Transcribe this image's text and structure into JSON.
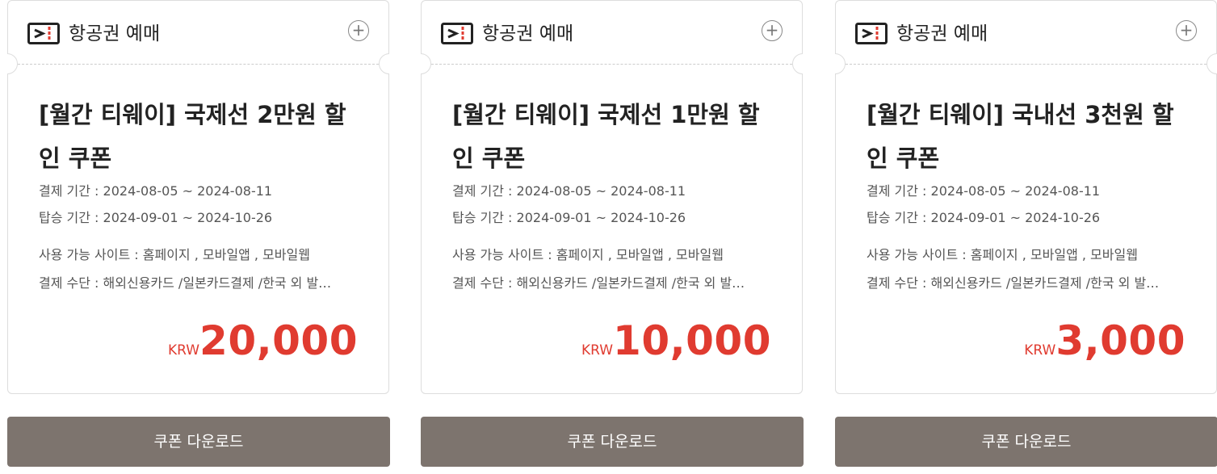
{
  "coupons": [
    {
      "category": "항공권 예매",
      "title": "[월간 티웨이] 국제선 2만원 할인 쿠폰",
      "payment_period": "결제 기간 : 2024-08-05 ~ 2024-08-11",
      "boarding_period": "탑승 기간 : 2024-09-01 ~ 2024-10-26",
      "sites": "사용 가능 사이트 : 홈페이지 , 모바일앱 , 모바일웹",
      "payment_method": "결제 수단 : 해외신용카드 /일본카드결제 /한국 외 발…",
      "currency": "KRW",
      "amount": "20,000",
      "button_label": "쿠폰 다운로드"
    },
    {
      "category": "항공권 예매",
      "title": "[월간 티웨이] 국제선 1만원 할인 쿠폰",
      "payment_period": "결제 기간 : 2024-08-05 ~ 2024-08-11",
      "boarding_period": "탑승 기간 : 2024-09-01 ~ 2024-10-26",
      "sites": "사용 가능 사이트 : 홈페이지 , 모바일앱 , 모바일웹",
      "payment_method": "결제 수단 : 해외신용카드 /일본카드결제 /한국 외 발…",
      "currency": "KRW",
      "amount": "10,000",
      "button_label": "쿠폰 다운로드"
    },
    {
      "category": "항공권 예매",
      "title": "[월간 티웨이] 국내선 3천원 할인 쿠폰",
      "payment_period": "결제 기간 : 2024-08-05 ~ 2024-08-11",
      "boarding_period": "탑승 기간 : 2024-09-01 ~ 2024-10-26",
      "sites": "사용 가능 사이트 : 홈페이지 , 모바일앱 , 모바일웹",
      "payment_method": "결제 수단 : 해외신용카드 /일본카드결제 /한국 외 발…",
      "currency": "KRW",
      "amount": "3,000",
      "button_label": "쿠폰 다운로드"
    }
  ],
  "icons": {
    "ticket": "ticket-icon",
    "plus": "plus-circle-icon"
  },
  "colors": {
    "price": "#e03b30",
    "button": "#7d746e",
    "border": "#dddddd"
  }
}
